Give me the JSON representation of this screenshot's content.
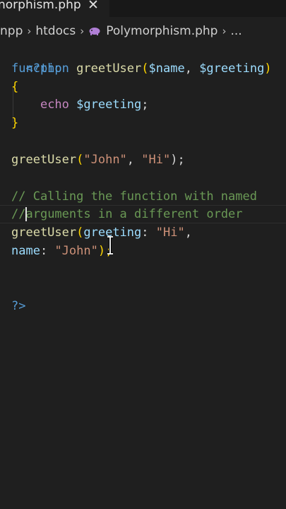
{
  "tab": {
    "label": "norphism.php",
    "close_glyph": "✕"
  },
  "breadcrumb": {
    "items": [
      "npp",
      "htdocs",
      "Polymorphism.php",
      "..."
    ],
    "separator": "›",
    "file_icon": "php-elephant-icon"
  },
  "code": {
    "open_tag": "<?php",
    "l_function_kw": "function",
    "l_function_name": "greetUser",
    "l_function_params_open": "(",
    "l_param1": "$name",
    "l_comma": ", ",
    "l_param2": "$greeting",
    "l_function_params_close": ")",
    "brace_open": "{",
    "echo_kw": "echo",
    "echo_var": "$greeting",
    "echo_semi": ";",
    "brace_close": "}",
    "call1_fn": "greetUser",
    "call1_open": "(",
    "call1_arg1": "\"John\"",
    "call1_comma": ", ",
    "call1_arg2": "\"Hi\"",
    "call1_close": ");",
    "comment1": "// Calling the function with named",
    "comment2_prefix": "//",
    "comment2_rest": "arguments in a different order",
    "call2_fn": "greetUser",
    "call2_open": "(",
    "call2_param1": "greeting",
    "call2_colon1": ": ",
    "call2_arg1": "\"Hi\"",
    "call2_comma": ",",
    "call2_param2": "name",
    "call2_colon2": ": ",
    "call2_arg2": "\"John\"",
    "call2_close": ");",
    "close_tag": "?>"
  },
  "colors": {
    "background": "#1f1f1f",
    "keyword": "#569cd6",
    "function": "#dcdcaa",
    "variable": "#9cdcfe",
    "string": "#ce9178",
    "comment": "#6a9955",
    "bracket": "#ffd700",
    "echo": "#c586c0"
  }
}
